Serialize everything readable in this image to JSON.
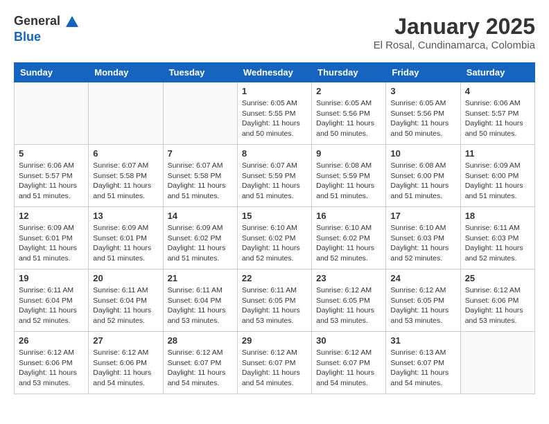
{
  "header": {
    "logo_general": "General",
    "logo_blue": "Blue",
    "month_title": "January 2025",
    "location": "El Rosal, Cundinamarca, Colombia"
  },
  "weekdays": [
    "Sunday",
    "Monday",
    "Tuesday",
    "Wednesday",
    "Thursday",
    "Friday",
    "Saturday"
  ],
  "weeks": [
    [
      {
        "day": "",
        "sunrise": "",
        "sunset": "",
        "daylight": ""
      },
      {
        "day": "",
        "sunrise": "",
        "sunset": "",
        "daylight": ""
      },
      {
        "day": "",
        "sunrise": "",
        "sunset": "",
        "daylight": ""
      },
      {
        "day": "1",
        "sunrise": "Sunrise: 6:05 AM",
        "sunset": "Sunset: 5:55 PM",
        "daylight": "Daylight: 11 hours and 50 minutes."
      },
      {
        "day": "2",
        "sunrise": "Sunrise: 6:05 AM",
        "sunset": "Sunset: 5:56 PM",
        "daylight": "Daylight: 11 hours and 50 minutes."
      },
      {
        "day": "3",
        "sunrise": "Sunrise: 6:05 AM",
        "sunset": "Sunset: 5:56 PM",
        "daylight": "Daylight: 11 hours and 50 minutes."
      },
      {
        "day": "4",
        "sunrise": "Sunrise: 6:06 AM",
        "sunset": "Sunset: 5:57 PM",
        "daylight": "Daylight: 11 hours and 50 minutes."
      }
    ],
    [
      {
        "day": "5",
        "sunrise": "Sunrise: 6:06 AM",
        "sunset": "Sunset: 5:57 PM",
        "daylight": "Daylight: 11 hours and 51 minutes."
      },
      {
        "day": "6",
        "sunrise": "Sunrise: 6:07 AM",
        "sunset": "Sunset: 5:58 PM",
        "daylight": "Daylight: 11 hours and 51 minutes."
      },
      {
        "day": "7",
        "sunrise": "Sunrise: 6:07 AM",
        "sunset": "Sunset: 5:58 PM",
        "daylight": "Daylight: 11 hours and 51 minutes."
      },
      {
        "day": "8",
        "sunrise": "Sunrise: 6:07 AM",
        "sunset": "Sunset: 5:59 PM",
        "daylight": "Daylight: 11 hours and 51 minutes."
      },
      {
        "day": "9",
        "sunrise": "Sunrise: 6:08 AM",
        "sunset": "Sunset: 5:59 PM",
        "daylight": "Daylight: 11 hours and 51 minutes."
      },
      {
        "day": "10",
        "sunrise": "Sunrise: 6:08 AM",
        "sunset": "Sunset: 6:00 PM",
        "daylight": "Daylight: 11 hours and 51 minutes."
      },
      {
        "day": "11",
        "sunrise": "Sunrise: 6:09 AM",
        "sunset": "Sunset: 6:00 PM",
        "daylight": "Daylight: 11 hours and 51 minutes."
      }
    ],
    [
      {
        "day": "12",
        "sunrise": "Sunrise: 6:09 AM",
        "sunset": "Sunset: 6:01 PM",
        "daylight": "Daylight: 11 hours and 51 minutes."
      },
      {
        "day": "13",
        "sunrise": "Sunrise: 6:09 AM",
        "sunset": "Sunset: 6:01 PM",
        "daylight": "Daylight: 11 hours and 51 minutes."
      },
      {
        "day": "14",
        "sunrise": "Sunrise: 6:09 AM",
        "sunset": "Sunset: 6:02 PM",
        "daylight": "Daylight: 11 hours and 51 minutes."
      },
      {
        "day": "15",
        "sunrise": "Sunrise: 6:10 AM",
        "sunset": "Sunset: 6:02 PM",
        "daylight": "Daylight: 11 hours and 52 minutes."
      },
      {
        "day": "16",
        "sunrise": "Sunrise: 6:10 AM",
        "sunset": "Sunset: 6:02 PM",
        "daylight": "Daylight: 11 hours and 52 minutes."
      },
      {
        "day": "17",
        "sunrise": "Sunrise: 6:10 AM",
        "sunset": "Sunset: 6:03 PM",
        "daylight": "Daylight: 11 hours and 52 minutes."
      },
      {
        "day": "18",
        "sunrise": "Sunrise: 6:11 AM",
        "sunset": "Sunset: 6:03 PM",
        "daylight": "Daylight: 11 hours and 52 minutes."
      }
    ],
    [
      {
        "day": "19",
        "sunrise": "Sunrise: 6:11 AM",
        "sunset": "Sunset: 6:04 PM",
        "daylight": "Daylight: 11 hours and 52 minutes."
      },
      {
        "day": "20",
        "sunrise": "Sunrise: 6:11 AM",
        "sunset": "Sunset: 6:04 PM",
        "daylight": "Daylight: 11 hours and 52 minutes."
      },
      {
        "day": "21",
        "sunrise": "Sunrise: 6:11 AM",
        "sunset": "Sunset: 6:04 PM",
        "daylight": "Daylight: 11 hours and 53 minutes."
      },
      {
        "day": "22",
        "sunrise": "Sunrise: 6:11 AM",
        "sunset": "Sunset: 6:05 PM",
        "daylight": "Daylight: 11 hours and 53 minutes."
      },
      {
        "day": "23",
        "sunrise": "Sunrise: 6:12 AM",
        "sunset": "Sunset: 6:05 PM",
        "daylight": "Daylight: 11 hours and 53 minutes."
      },
      {
        "day": "24",
        "sunrise": "Sunrise: 6:12 AM",
        "sunset": "Sunset: 6:05 PM",
        "daylight": "Daylight: 11 hours and 53 minutes."
      },
      {
        "day": "25",
        "sunrise": "Sunrise: 6:12 AM",
        "sunset": "Sunset: 6:06 PM",
        "daylight": "Daylight: 11 hours and 53 minutes."
      }
    ],
    [
      {
        "day": "26",
        "sunrise": "Sunrise: 6:12 AM",
        "sunset": "Sunset: 6:06 PM",
        "daylight": "Daylight: 11 hours and 53 minutes."
      },
      {
        "day": "27",
        "sunrise": "Sunrise: 6:12 AM",
        "sunset": "Sunset: 6:06 PM",
        "daylight": "Daylight: 11 hours and 54 minutes."
      },
      {
        "day": "28",
        "sunrise": "Sunrise: 6:12 AM",
        "sunset": "Sunset: 6:07 PM",
        "daylight": "Daylight: 11 hours and 54 minutes."
      },
      {
        "day": "29",
        "sunrise": "Sunrise: 6:12 AM",
        "sunset": "Sunset: 6:07 PM",
        "daylight": "Daylight: 11 hours and 54 minutes."
      },
      {
        "day": "30",
        "sunrise": "Sunrise: 6:12 AM",
        "sunset": "Sunset: 6:07 PM",
        "daylight": "Daylight: 11 hours and 54 minutes."
      },
      {
        "day": "31",
        "sunrise": "Sunrise: 6:13 AM",
        "sunset": "Sunset: 6:07 PM",
        "daylight": "Daylight: 11 hours and 54 minutes."
      },
      {
        "day": "",
        "sunrise": "",
        "sunset": "",
        "daylight": ""
      }
    ]
  ]
}
